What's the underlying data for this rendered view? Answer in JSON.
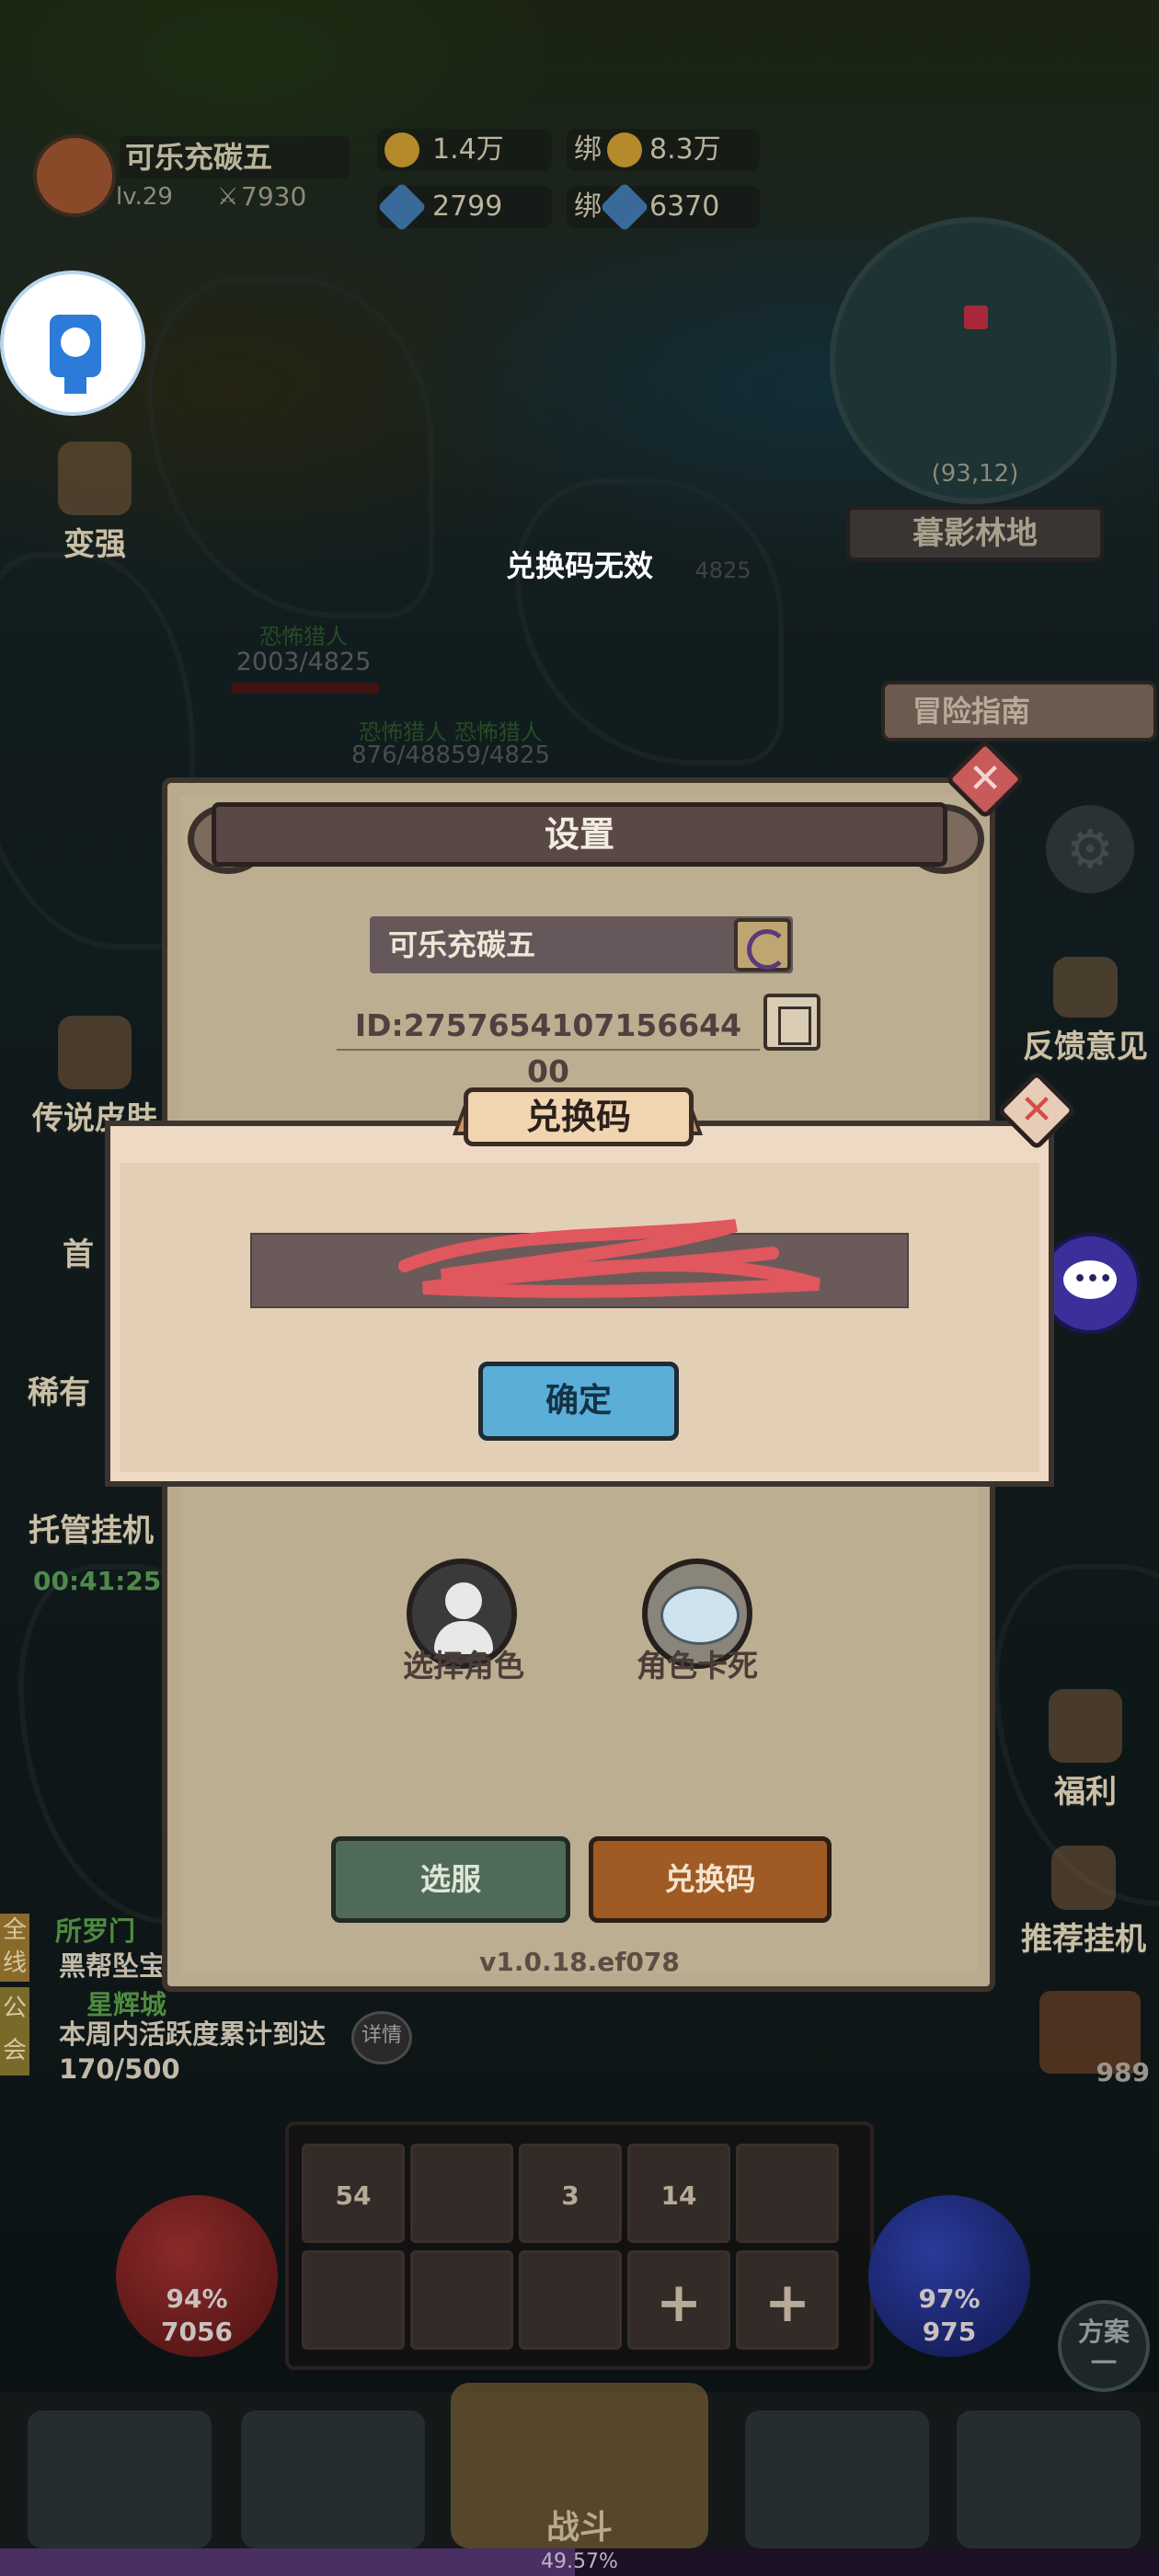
{
  "hud": {
    "player_name": "可乐充碳五",
    "level": "lv.29",
    "power": "7930",
    "gold": "1.4万",
    "bound_gold_prefix": "绑",
    "bound_gold": "8.3万",
    "diamonds": "2799",
    "bound_diamond_prefix": "绑",
    "bound_diamonds": "6370",
    "minimap_coords": "(93,12)",
    "map_name": "暮影林地",
    "guide_label": "冒险指南",
    "feedback_label": "反馈意见",
    "welfare_label": "福利",
    "recommend_label": "推荐挂机",
    "chest_count": "989",
    "strengthen_label": "变强",
    "legend_skin_label": "传说皮肤",
    "first_charge_label": "首",
    "rare_label": "稀有",
    "auto_label": "托管挂机",
    "auto_timer": "00:41:25"
  },
  "toast": {
    "message": "兑换码无效"
  },
  "world": {
    "enemy_name": "恐怖猎人",
    "enemy_hp": "2003/4825",
    "enemy_group_names": "恐怖猎人 恐怖猎人",
    "enemy_group_hp": "876/48859/4825",
    "faint_hp": "4825"
  },
  "settings": {
    "title": "设置",
    "player_name": "可乐充碳五",
    "player_id": "ID:2757654107156644​00",
    "select_role_label": "选择角色",
    "role_stuck_label": "角色卡死",
    "select_server_label": "选服",
    "redeem_code_label": "兑换码",
    "version": "v1.0.18.ef078"
  },
  "redeem_dialog": {
    "title": "兑换码",
    "input_value": "...",
    "confirm_label": "确定"
  },
  "chat": {
    "tag_all": "全线",
    "tag_guild": "公会",
    "line1": "所罗门",
    "line2": "黑帮坠宝",
    "line3": "星辉城",
    "activity_text": "本周内活跃度累计到达170/500",
    "detail_label": "详情"
  },
  "skills": {
    "slot_counts": [
      "54",
      "",
      "3",
      "14",
      ""
    ]
  },
  "stats": {
    "hp_percent": "94%",
    "hp_value": "7056",
    "mp_percent": "97%",
    "mp_value": "975",
    "plan_label": "方案",
    "plan_number": "一"
  },
  "nav": {
    "battle_label": "战斗",
    "xp_percent": "49.57%",
    "xp_fraction": 0.4957
  },
  "colors": {
    "accent_blue": "#5aaed8",
    "code_button_orange": "#a05a23",
    "server_button_green": "#4f6b58",
    "close_red": "#d84a4a"
  }
}
